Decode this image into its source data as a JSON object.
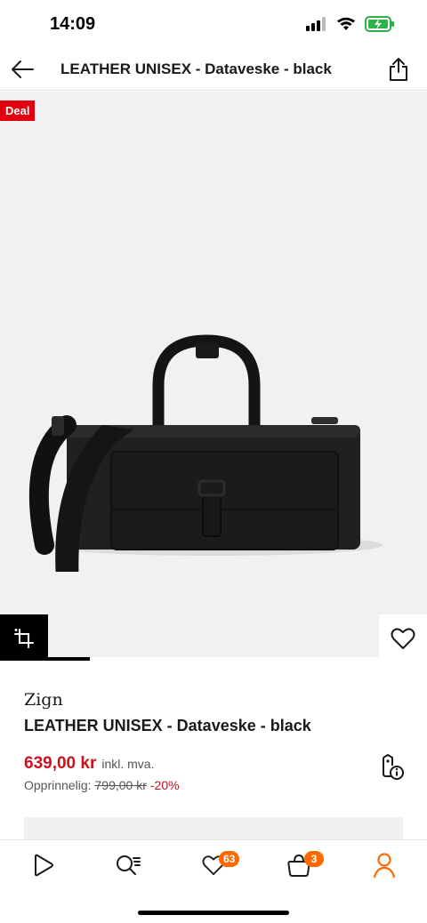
{
  "status_bar": {
    "time": "14:09",
    "battery_color": "#2bb24a"
  },
  "header": {
    "title": "LEATHER UNISEX - Dataveske - black"
  },
  "gallery": {
    "deal_badge": "Deal",
    "image_progress_fraction": 0.125,
    "image_description_icon": "briefcase-product-image"
  },
  "product": {
    "brand": "Zign",
    "name": "LEATHER UNISEX - Dataveske - black",
    "price": "639,00 kr",
    "vat_note": "inkl. mva.",
    "original_label": "Opprinnelig:",
    "original_price": "799,00 kr",
    "discount": "-20%",
    "price_color": "#c7131b"
  },
  "tab_bar": {
    "accent_color": "#ff6900",
    "items": [
      {
        "icon": "play-icon"
      },
      {
        "icon": "search-list-icon"
      },
      {
        "icon": "heart-icon",
        "badge": "63"
      },
      {
        "icon": "bag-icon",
        "badge": "3"
      },
      {
        "icon": "profile-icon"
      }
    ]
  }
}
